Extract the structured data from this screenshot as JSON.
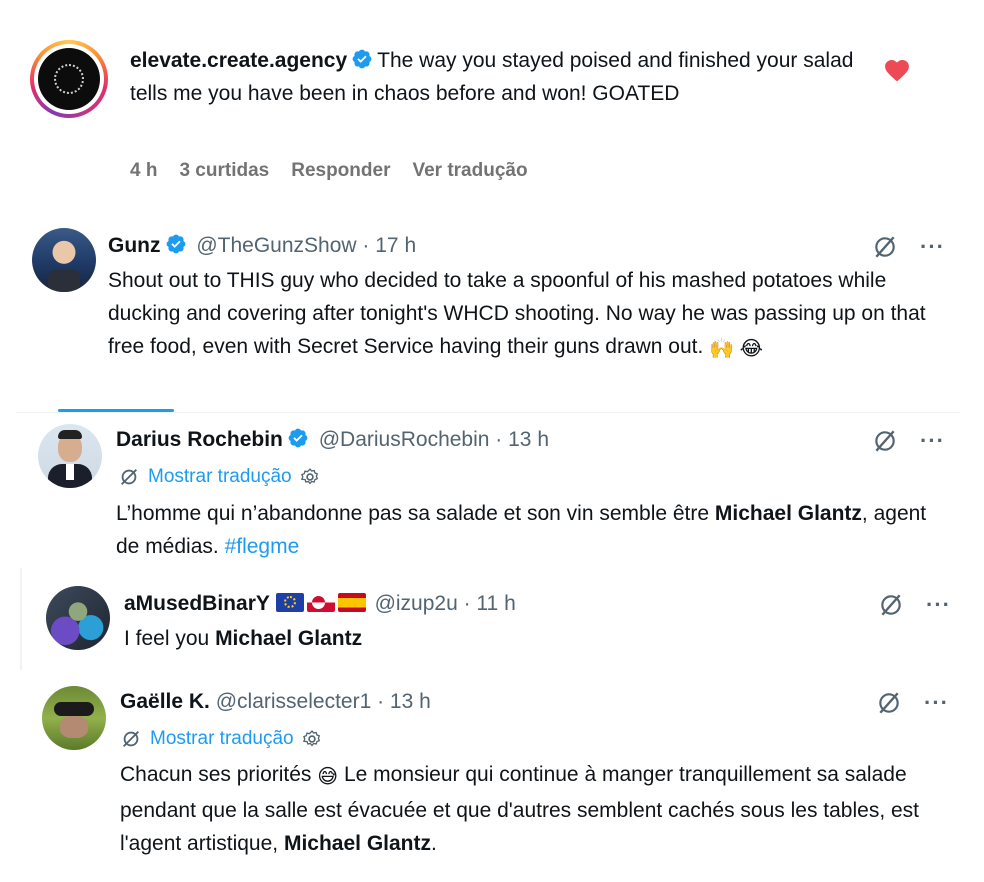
{
  "instagram_comment": {
    "username": "elevate.create.agency",
    "text": "The way you stayed poised and finished your salad tells me you have been in chaos before and won! GOATED",
    "time": "4 h",
    "likes": "3 curtidas",
    "reply": "Responder",
    "translate": "Ver tradução"
  },
  "tweets": [
    {
      "name": "Gunz",
      "handle": "@TheGunzShow",
      "time": "· 17 h",
      "text": "Shout out to THIS guy who decided to take a spoonful of his mashed potatoes while ducking and covering after tonight's WHCD shooting. No way he was passing up on that free food, even with Secret Service having their guns drawn out.",
      "emojis": "🙌 😂"
    },
    {
      "name": "Darius Rochebin",
      "handle": "@DariusRochebin",
      "time": "· 13 h",
      "translate_label": "Mostrar tradução",
      "text_before": "L’homme qui n’abandonne pas sa salade et son vin semble être ",
      "text_bold": "Michael Glantz",
      "text_after": ", agent de médias. ",
      "hashtag": "#flegme"
    },
    {
      "name": "aMusedBinarY",
      "handle": "@izup2u",
      "time": "· 11 h",
      "text_before": "I feel you ",
      "text_bold": "Michael Glantz"
    },
    {
      "name": "Gaëlle K.",
      "handle": "@clarisselecter1",
      "time": "· 13 h",
      "translate_label": "Mostrar tradução",
      "text_before": "Chacun ses priorités ",
      "emoji": "😅",
      "text_middle": " Le monsieur qui continue à manger tranquillement sa salade pendant que la salle est évacuée et que d'autres semblent cachés sous les tables, est l'agent artistique, ",
      "text_bold": "Michael Glantz",
      "text_after": "."
    }
  ],
  "icons": [
    "verified-badge-icon",
    "heart-icon",
    "grok-icon",
    "more-icon",
    "translate-icon",
    "settings-icon"
  ],
  "colors": {
    "accent": "#1d9bf0",
    "heart": "#ed4956",
    "text": "#0f1419",
    "muted": "#536471"
  }
}
